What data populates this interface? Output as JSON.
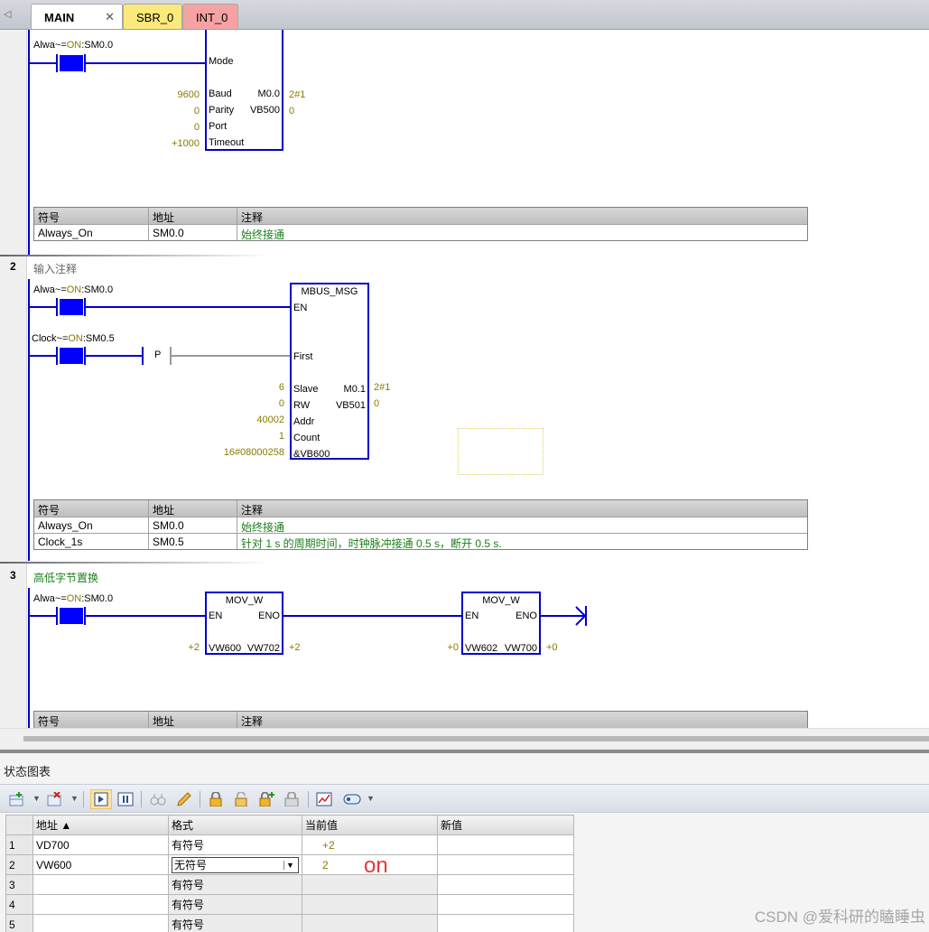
{
  "tabs": [
    {
      "label": "MAIN",
      "close": "✕"
    },
    {
      "label": "SBR_0"
    },
    {
      "label": "INT_0"
    }
  ],
  "network1": {
    "contact": {
      "name": "Alwa~",
      "eq": "=",
      "state": "ON",
      "addr": ":SM0.0"
    },
    "box": {
      "mode_pin": "Mode",
      "inputs": [
        {
          "value": "9600",
          "pin": "Baud"
        },
        {
          "value": "0",
          "pin": "Parity"
        },
        {
          "value": "0",
          "pin": "Port"
        },
        {
          "value": "+1000",
          "pin": "Timeout"
        }
      ],
      "outputs": [
        {
          "pin": "M0.0",
          "value": "2#1"
        },
        {
          "pin": "VB500",
          "value": "0"
        }
      ]
    },
    "symtab": {
      "headers": [
        "符号",
        "地址",
        "注释"
      ],
      "rows": [
        {
          "symbol": "Always_On",
          "addr": "SM0.0",
          "comment": "始终接通"
        }
      ]
    }
  },
  "network2": {
    "number": "2",
    "comment": "输入注释",
    "contact1": {
      "name": "Alwa~",
      "eq": "=",
      "state": "ON",
      "addr": ":SM0.0"
    },
    "contact2": {
      "name": "Clock~",
      "eq": "=",
      "state": "ON",
      "addr": ":SM0.5"
    },
    "p_label": "P",
    "box": {
      "title": "MBUS_MSG",
      "en": "EN",
      "first": "First",
      "inputs": [
        {
          "value": "6",
          "pin": "Slave"
        },
        {
          "value": "0",
          "pin": "RW"
        },
        {
          "value": "40002",
          "pin": "Addr"
        },
        {
          "value": "1",
          "pin": "Count"
        },
        {
          "value": "16#08000258",
          "pin": "&VB600"
        }
      ],
      "outputs": [
        {
          "pin": "M0.1",
          "value": "2#1"
        },
        {
          "pin": "VB501",
          "value": "0"
        }
      ]
    },
    "symtab": {
      "headers": [
        "符号",
        "地址",
        "注释"
      ],
      "rows": [
        {
          "symbol": "Always_On",
          "addr": "SM0.0",
          "comment": "始终接通"
        },
        {
          "symbol": "Clock_1s",
          "addr": "SM0.5",
          "comment": "针对 1 s 的周期时间，时钟脉冲接通 0.5 s，断开 0.5 s."
        }
      ]
    }
  },
  "network3": {
    "number": "3",
    "comment": "高低字节置换",
    "contact": {
      "name": "Alwa~",
      "eq": "=",
      "state": "ON",
      "addr": ":SM0.0"
    },
    "box1": {
      "title": "MOV_W",
      "en": "EN",
      "eno": "ENO",
      "in_val": "+2",
      "in_pin": "VW600",
      "out_pin": "VW702",
      "out_val": "+2"
    },
    "box2": {
      "title": "MOV_W",
      "en": "EN",
      "eno": "ENO",
      "in_val": "+0",
      "in_pin": "VW602",
      "out_pin": "VW700",
      "out_val": "+0"
    },
    "symtab": {
      "headers": [
        "符号",
        "地址",
        "注释"
      ]
    }
  },
  "status_chart": {
    "title": "状态图表",
    "columns": [
      "地址 ▲",
      "格式",
      "当前值",
      "新值"
    ],
    "rows": [
      {
        "idx": "1",
        "addr": "VD700",
        "fmt": "有符号",
        "cur": "+2",
        "new": ""
      },
      {
        "idx": "2",
        "addr": "VW600",
        "fmt": "无符号",
        "cur": "2",
        "new": ""
      },
      {
        "idx": "3",
        "addr": "",
        "fmt": "有符号",
        "cur": "",
        "new": ""
      },
      {
        "idx": "4",
        "addr": "",
        "fmt": "有符号",
        "cur": "",
        "new": ""
      },
      {
        "idx": "5",
        "addr": "",
        "fmt": "有符号",
        "cur": "",
        "new": ""
      }
    ],
    "annotation": "on"
  },
  "watermark": "CSDN @爱科研的瞌睡虫",
  "colors": {
    "wire": "#0000cc",
    "contact": "#0000ff",
    "value": "#8a7a00",
    "comment": "#1b7f1b",
    "annotation": "#e53935"
  }
}
